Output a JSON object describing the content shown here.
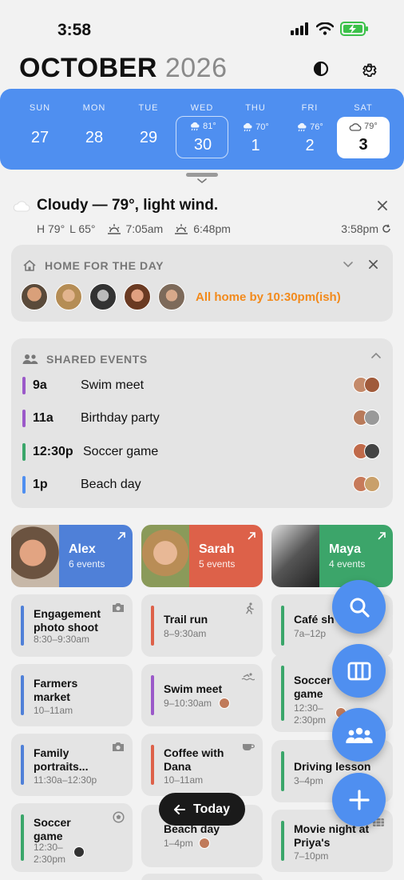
{
  "status_bar": {
    "time": "3:58"
  },
  "header": {
    "month": "OCTOBER",
    "year": "2026"
  },
  "week": {
    "days": [
      {
        "dow": "SUN",
        "num": "27"
      },
      {
        "dow": "MON",
        "num": "28"
      },
      {
        "dow": "TUE",
        "num": "29"
      },
      {
        "dow": "WED",
        "num": "30",
        "temp": "81°"
      },
      {
        "dow": "THU",
        "num": "1",
        "temp": "70°"
      },
      {
        "dow": "FRI",
        "num": "2",
        "temp": "76°"
      },
      {
        "dow": "SAT",
        "num": "3",
        "temp": "79°"
      }
    ]
  },
  "weather": {
    "summary": "Cloudy — 79°, light wind.",
    "high": "H 79°",
    "low": "L 65°",
    "sunrise": "7:05am",
    "sunset": "6:48pm",
    "updated": "3:58pm"
  },
  "home_card": {
    "title": "HOME FOR THE DAY",
    "status": "All home by 10:30pm(ish)"
  },
  "shared_events": {
    "title": "SHARED EVENTS",
    "items": [
      {
        "time": "9a",
        "name": "Swim meet",
        "color": "#9b59c9"
      },
      {
        "time": "11a",
        "name": "Birthday party",
        "color": "#9b59c9"
      },
      {
        "time": "12:30p",
        "name": "Soccer game",
        "color": "#3aa66a"
      },
      {
        "time": "1p",
        "name": "Beach day",
        "color": "#4f8ff0"
      }
    ]
  },
  "people": [
    {
      "name": "Alex",
      "count": "6 events",
      "color": "#4f80d8"
    },
    {
      "name": "Sarah",
      "count": "5 events",
      "color": "#dd6149"
    },
    {
      "name": "Maya",
      "count": "4 events",
      "color": "#3ca56a"
    }
  ],
  "columns": {
    "alex": [
      {
        "title": "Engagement photo shoot",
        "time": "8:30–9:30am",
        "icon": "camera-icon"
      },
      {
        "title": "Farmers market",
        "time": "10–11am"
      },
      {
        "title": "Family portraits...",
        "time": "11:30a–12:30p",
        "icon": "camera-icon"
      },
      {
        "title": "Soccer game",
        "time": "12:30–2:30pm",
        "icon": "soccer-ball-icon"
      }
    ],
    "sarah": [
      {
        "title": "Trail run",
        "time": "8–9:30am",
        "icon": "runner-icon"
      },
      {
        "title": "Swim meet",
        "time": "9–10:30am",
        "icon": "swimmer-icon"
      },
      {
        "title": "Coffee with Dana",
        "time": "10–11am",
        "icon": "coffee-cup-icon"
      },
      {
        "title": "Beach day",
        "time": "1–4pm"
      }
    ],
    "maya": [
      {
        "title": "Café shift",
        "title_visible": "Café sh",
        "time": "7a–12p"
      },
      {
        "title": "Soccer game",
        "time": "12:30–2:30pm"
      },
      {
        "title": "Driving lesson",
        "time": "3–4pm"
      },
      {
        "title": "Movie night at Priya's",
        "time": "7–10pm",
        "icon": "film-icon"
      }
    ]
  },
  "today_button": {
    "label": "Today"
  },
  "colors": {
    "accent": "#4f8ff0",
    "orange": "#f28a1c"
  }
}
